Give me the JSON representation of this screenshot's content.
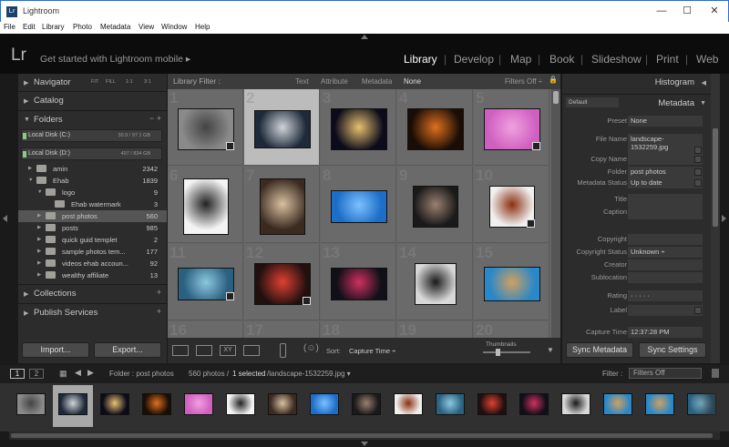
{
  "window": {
    "title": "Lightroom",
    "app_icon": "Lr",
    "controls": [
      "—",
      "☐",
      "✕"
    ]
  },
  "menu": [
    "File",
    "Edit",
    "Library",
    "Photo",
    "Metadata",
    "View",
    "Window",
    "Help"
  ],
  "identity": {
    "logo": "Lr",
    "mobile_prompt": "Get started with Lightroom mobile",
    "mobile_arrow": "▸"
  },
  "modules": [
    "Library",
    "Develop",
    "Map",
    "Book",
    "Slideshow",
    "Print",
    "Web"
  ],
  "active_module": "Library",
  "left_panel": {
    "navigator": {
      "label": "Navigator",
      "zoom": [
        "FIT",
        "FILL",
        "1:1",
        "3:1"
      ]
    },
    "catalog": "Catalog",
    "folders": {
      "label": "Folders",
      "actions": "− +"
    },
    "disks": [
      {
        "name": "Local Disk (C:)",
        "size": "30.9 / 97.1 GB"
      },
      {
        "name": "Local Disk (D:)",
        "size": "497 / 834 GB"
      }
    ],
    "folder_rows": [
      {
        "name": "amin",
        "count": "2342"
      },
      {
        "name": "Ehab",
        "count": "1839"
      },
      {
        "name": "logo",
        "count": "9"
      },
      {
        "name": "Ehab watermark",
        "count": "3"
      },
      {
        "name": "post photos",
        "count": "560"
      },
      {
        "name": "posts",
        "count": "985"
      },
      {
        "name": "quick guid templet",
        "count": "2"
      },
      {
        "name": "sample photos tem...",
        "count": "177"
      },
      {
        "name": "videos ehab accoun...",
        "count": "92"
      },
      {
        "name": "wealthy affiliate",
        "count": "13"
      }
    ],
    "collections": "Collections",
    "publish": "Publish Services",
    "import_btn": "Import...",
    "export_btn": "Export..."
  },
  "filter_bar": {
    "label": "Library Filter :",
    "tabs": [
      "Text",
      "Attribute",
      "Metadata",
      "None"
    ],
    "off": "Filters Off ÷"
  },
  "grid_numbers": [
    "1",
    "2",
    "3",
    "4",
    "5",
    "6",
    "7",
    "8",
    "9",
    "10",
    "11",
    "12",
    "13",
    "14",
    "15",
    "16",
    "17",
    "18",
    "19",
    "20"
  ],
  "thumb_colors": [
    [
      "#8a8a8a",
      "#444"
    ],
    [
      "#1e2a3a",
      "#d0d4d8"
    ],
    [
      "#0b0b1a",
      "#e8c070"
    ],
    [
      "#1a0d05",
      "#e07020"
    ],
    [
      "#d060c0",
      "#f0a0e0"
    ],
    [
      "#f4f4f4",
      "#222"
    ],
    [
      "#3a2a20",
      "#d8c0a0"
    ],
    [
      "#1e6ec8",
      "#7cc0ff"
    ],
    [
      "#1a1a1a",
      "#9a8070"
    ],
    [
      "#f0f0f0",
      "#8a3010"
    ],
    [
      "#2a6080",
      "#8cc8e0"
    ],
    [
      "#201010",
      "#e04030"
    ],
    [
      "#101018",
      "#d03060"
    ],
    [
      "#d8d8d8",
      "#1a1a1a"
    ],
    [
      "#2a88c8",
      "#d0a060"
    ]
  ],
  "toolbar": {
    "sort_label": "Sort:",
    "sort_value": "Capture Time ÷",
    "thumbnails": "Thumbnails"
  },
  "right_panel": {
    "histogram": "Histogram",
    "preset_dd": "Default",
    "metadata": "Metadata",
    "rows": [
      {
        "label": "Preset",
        "value": "None"
      },
      {
        "label": "File Name",
        "value": "landscape-1532259.jpg"
      },
      {
        "label": "Copy Name",
        "value": ""
      },
      {
        "label": "Folder",
        "value": "post photos"
      },
      {
        "label": "Metadata Status",
        "value": "Up to date"
      },
      {
        "label": "Title",
        "value": ""
      },
      {
        "label": "Caption",
        "value": ""
      },
      {
        "label": "Copyright",
        "value": ""
      },
      {
        "label": "Copyright Status",
        "value": "Unknown ÷"
      },
      {
        "label": "Creator",
        "value": ""
      },
      {
        "label": "Sublocation",
        "value": ""
      },
      {
        "label": "Rating",
        "value": "·  ·  ·  ·  ·"
      },
      {
        "label": "Label",
        "value": ""
      },
      {
        "label": "Capture Time",
        "value": "12:37:28 PM"
      }
    ],
    "sync_metadata": "Sync Metadata",
    "sync_settings": "Sync Settings"
  },
  "filmstrip_bar": {
    "pages": [
      "1",
      "2"
    ],
    "folder": "Folder : post photos",
    "count": "560 photos /",
    "selected": "1 selected",
    "file": "/landscape-1532259.jpg ▾",
    "filter_label": "Filter :",
    "filter_value": "Filters Off"
  }
}
